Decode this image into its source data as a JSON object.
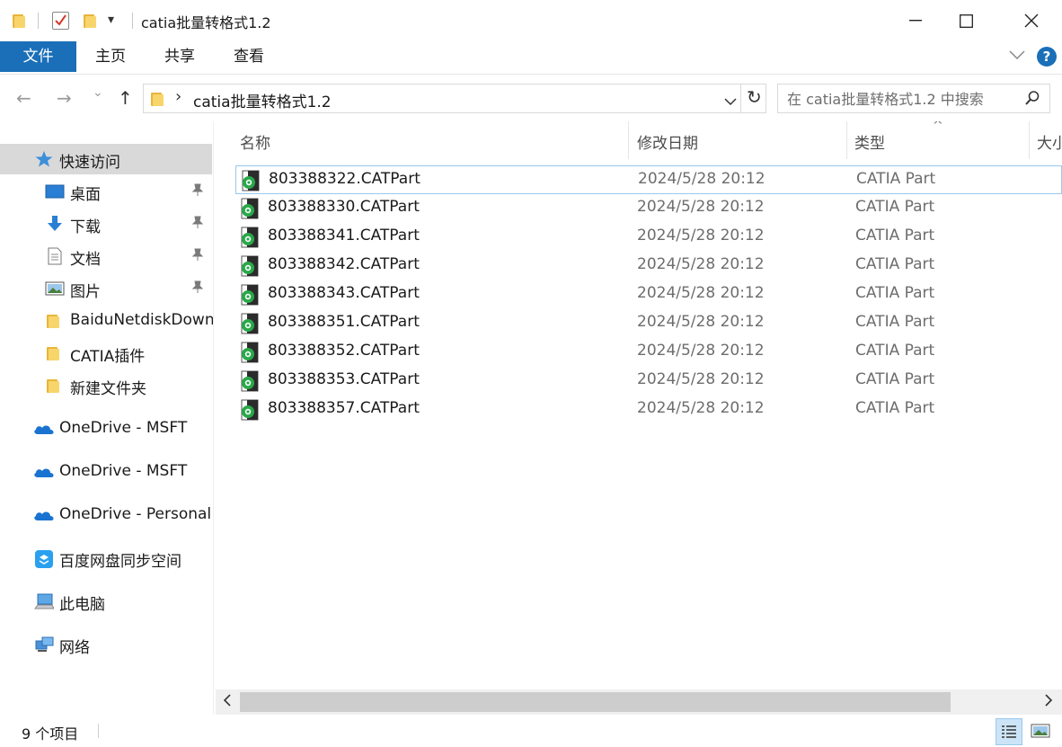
{
  "window": {
    "title": "catia批量转格式1.2",
    "minimize_glyph": "—",
    "maximize_glyph": "☐",
    "close_glyph": "✕"
  },
  "quick_access": {
    "customize_glyph": "▾"
  },
  "ribbon": {
    "tabs": [
      {
        "label": "文件",
        "active": true
      },
      {
        "label": "主页",
        "active": false
      },
      {
        "label": "共享",
        "active": false
      },
      {
        "label": "查看",
        "active": false
      }
    ],
    "expand_glyph": "﹀",
    "help_glyph": "?"
  },
  "nav": {
    "back_glyph": "←",
    "forward_glyph": "→",
    "recent_glyph": "⌄",
    "up_glyph": "↑"
  },
  "address": {
    "separator": "›",
    "path": "catia批量转格式1.2",
    "dropdown_glyph": "⌄",
    "refresh_glyph": "↻"
  },
  "search": {
    "placeholder": "在 catia批量转格式1.2 中搜索",
    "icon_glyph": "⚲"
  },
  "sidebar": {
    "items": [
      {
        "label": "快速访问",
        "icon": "star-icon",
        "selected": true
      },
      {
        "label": "桌面",
        "icon": "desktop-icon",
        "pinned": true
      },
      {
        "label": "下载",
        "icon": "download-icon",
        "pinned": true
      },
      {
        "label": "文档",
        "icon": "document-icon",
        "pinned": true
      },
      {
        "label": "图片",
        "icon": "picture-icon",
        "pinned": true
      },
      {
        "label": "BaiduNetdiskDownload",
        "icon": "folder-icon"
      },
      {
        "label": "CATIA插件",
        "icon": "folder-icon"
      },
      {
        "label": "新建文件夹",
        "icon": "folder-icon"
      },
      {
        "label": "OneDrive - MSFT",
        "icon": "cloud-icon"
      },
      {
        "label": "OneDrive - MSFT",
        "icon": "cloud-icon"
      },
      {
        "label": "OneDrive - Personal",
        "icon": "cloud-icon"
      },
      {
        "label": "百度网盘同步空间",
        "icon": "baidu-netdisk-icon"
      },
      {
        "label": "此电脑",
        "icon": "computer-icon"
      },
      {
        "label": "网络",
        "icon": "network-icon"
      }
    ],
    "pin_glyph": "📌"
  },
  "filelist": {
    "columns": {
      "name": "名称",
      "date": "修改日期",
      "type": "类型",
      "size": "大小"
    },
    "sort_glyph": "^",
    "rows": [
      {
        "name": "803388322.CATPart",
        "date": "2024/5/28 20:12",
        "type": "CATIA Part"
      },
      {
        "name": "803388330.CATPart",
        "date": "2024/5/28 20:12",
        "type": "CATIA Part"
      },
      {
        "name": "803388341.CATPart",
        "date": "2024/5/28 20:12",
        "type": "CATIA Part"
      },
      {
        "name": "803388342.CATPart",
        "date": "2024/5/28 20:12",
        "type": "CATIA Part"
      },
      {
        "name": "803388343.CATPart",
        "date": "2024/5/28 20:12",
        "type": "CATIA Part"
      },
      {
        "name": "803388351.CATPart",
        "date": "2024/5/28 20:12",
        "type": "CATIA Part"
      },
      {
        "name": "803388352.CATPart",
        "date": "2024/5/28 20:12",
        "type": "CATIA Part"
      },
      {
        "name": "803388353.CATPart",
        "date": "2024/5/28 20:12",
        "type": "CATIA Part"
      },
      {
        "name": "803388357.CATPart",
        "date": "2024/5/28 20:12",
        "type": "CATIA Part"
      }
    ]
  },
  "scrollbar": {
    "left_glyph": "‹",
    "right_glyph": "›"
  },
  "status": {
    "item_count": "9 个项目"
  },
  "colors": {
    "accent": "#1a6fb8",
    "selected_bg": "#d9d9d9",
    "focus_border": "#99c9ef",
    "folder": "#f8d56b"
  }
}
